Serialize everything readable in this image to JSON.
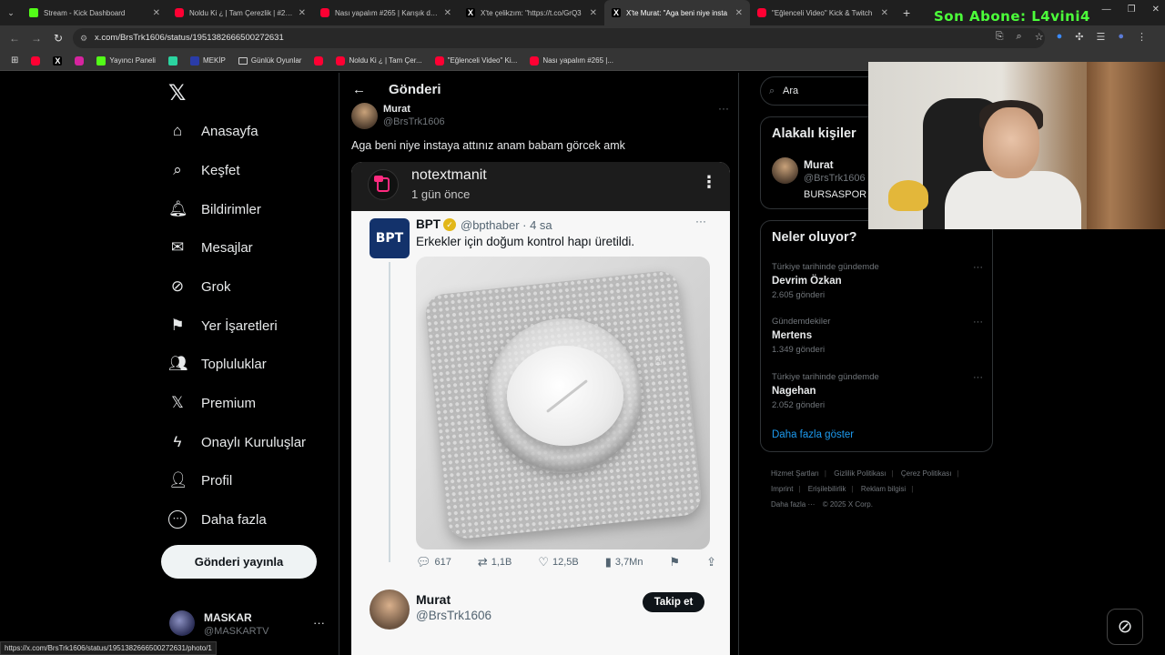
{
  "browser": {
    "tabs": [
      {
        "label": "Stream - Kick Dashboard",
        "icon": "kick"
      },
      {
        "label": "Noldu Ki ¿ | Tam Çerezlik | #243",
        "icon": "yt"
      },
      {
        "label": "Nası yapalım #265 | Karışık dert",
        "icon": "yt"
      },
      {
        "label": "X'te çelikzım: \"https://t.co/GrQ3",
        "icon": "x"
      },
      {
        "label": "X'te Murat: \"Aga beni niye insta",
        "icon": "x"
      },
      {
        "label": "\"Eğlenceli Video\" Kick & Twitch",
        "icon": "yt"
      }
    ],
    "new_tab": "+",
    "url": "x.com/BrsTrk1606/status/1951382666500272631",
    "bookmarks": [
      {
        "label": "",
        "icon": "yt"
      },
      {
        "label": "",
        "icon": "x"
      },
      {
        "label": "",
        "icon": "insta"
      },
      {
        "label": "Yayıncı Paneli",
        "icon": "kick"
      },
      {
        "label": "",
        "icon": "other"
      },
      {
        "label": "MEKİP",
        "icon": "folder"
      },
      {
        "label": "Günlük Oyunlar",
        "icon": "folder"
      },
      {
        "label": "",
        "icon": "yt"
      },
      {
        "label": "Noldu Ki ¿ | Tam Çer...",
        "icon": "yt"
      },
      {
        "label": "\"Eğlenceli Video\" Ki...",
        "icon": "yt"
      },
      {
        "label": "Nası yapalım #265 |...",
        "icon": "yt"
      }
    ],
    "status_url": "https://x.com/BrsTrk1606/status/1951382666500272631/photo/1"
  },
  "overlay": {
    "son_abone": "Son Abone: L4vini4"
  },
  "sidebar": {
    "logo": "𝕏",
    "items": [
      {
        "label": "Anasayfa",
        "icon": "home-icon",
        "glyph": "⌂"
      },
      {
        "label": "Keşfet",
        "icon": "search-icon",
        "glyph": "⌕"
      },
      {
        "label": "Bildirimler",
        "icon": "bell-icon",
        "glyph": "🔔︎"
      },
      {
        "label": "Mesajlar",
        "icon": "mail-icon",
        "glyph": "✉"
      },
      {
        "label": "Grok",
        "icon": "grok-icon",
        "glyph": "⊘"
      },
      {
        "label": "Yer İşaretleri",
        "icon": "bookmark-icon",
        "glyph": "⚑"
      },
      {
        "label": "Topluluklar",
        "icon": "communities-icon",
        "glyph": "👥︎"
      },
      {
        "label": "Premium",
        "icon": "x-premium-icon",
        "glyph": "𝕏"
      },
      {
        "label": "Onaylı Kuruluşlar",
        "icon": "lightning-icon",
        "glyph": "ϟ"
      },
      {
        "label": "Profil",
        "icon": "profile-icon",
        "glyph": "👤︎"
      },
      {
        "label": "Daha fazla",
        "icon": "more-circle-icon",
        "glyph": "⋯"
      }
    ],
    "post_button": "Gönderi yayınla",
    "account": {
      "name": "MASKAR",
      "handle": "@MASKARTV",
      "more": "···"
    }
  },
  "main": {
    "header_title": "Gönderi",
    "author": {
      "name": "Murat",
      "handle": "@BrsTrk1606"
    },
    "text": "Aga beni niye instaya attınız anam babam görcek amk",
    "embed": {
      "source_name": "notextmanit",
      "source_time": "1 gün önce",
      "quoted": {
        "avatar_text": "BPT",
        "name": "BPT",
        "handle": "@bpthaber · 4 sa",
        "text": "Erkekler için doğum kontrol hapı üretildi.",
        "stats": {
          "replies": "617",
          "reposts": "1,1B",
          "likes": "12,5B",
          "views": "3,7Mn"
        }
      },
      "reply_user": {
        "name": "Murat",
        "handle": "@BrsTrk1606",
        "follow": "Takip et"
      }
    }
  },
  "right": {
    "search_placeholder": "Ara",
    "related_title": "Alakalı kişiler",
    "related": {
      "name": "Murat",
      "handle": "@BrsTrk1606",
      "bio": "BURSASPOR"
    },
    "trends_title": "Neler oluyor?",
    "trends": [
      {
        "context": "Türkiye tarihinde gündemde",
        "name": "Devrim Özkan",
        "count": "2.605 gönderi"
      },
      {
        "context": "Gündemdekiler",
        "name": "Mertens",
        "count": "1.349 gönderi"
      },
      {
        "context": "Türkiye tarihinde gündemde",
        "name": "Nagehan",
        "count": "2.052 gönderi"
      }
    ],
    "show_more": "Daha fazla göster",
    "footer": [
      "Hizmet Şartları",
      "Gizlilik Politikası",
      "Çerez Politikası",
      "Imprint",
      "Erişilebilirlik",
      "Reklam bilgisi",
      "Daha fazla ···",
      "© 2025 X Corp."
    ]
  },
  "colors": {
    "accent": "#1d9bf0",
    "kick_green": "#53fc18",
    "overlay_green": "#4cff3a",
    "verified_gold": "#e2b719"
  }
}
